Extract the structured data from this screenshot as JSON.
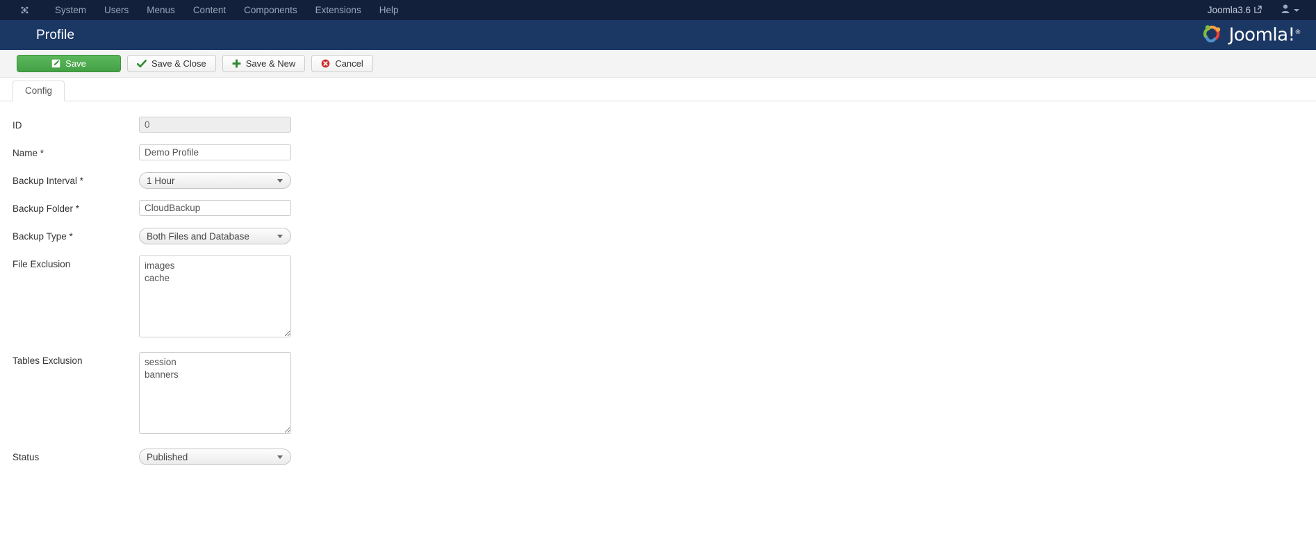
{
  "topnav": {
    "brand_icon": "joomla-emblem-icon",
    "menu": [
      {
        "label": "System"
      },
      {
        "label": "Users"
      },
      {
        "label": "Menus"
      },
      {
        "label": "Content"
      },
      {
        "label": "Components"
      },
      {
        "label": "Extensions"
      },
      {
        "label": "Help"
      }
    ],
    "site_link": {
      "label": "Joomla3.6",
      "icon": "external-link-icon"
    },
    "user_menu": {
      "icon": "user-icon",
      "caret": "chevron-down-icon"
    }
  },
  "header": {
    "title": "Profile",
    "logo_text": "Joomla!",
    "logo_reg": "®"
  },
  "toolbar": {
    "save_label": "Save",
    "save_close_label": "Save & Close",
    "save_new_label": "Save & New",
    "cancel_label": "Cancel"
  },
  "tabs": [
    {
      "label": "Config",
      "active": true
    }
  ],
  "form": {
    "fields": [
      {
        "label": "ID",
        "type": "text",
        "value": "0",
        "disabled": true
      },
      {
        "label": "Name *",
        "type": "text",
        "value": "Demo Profile",
        "disabled": false
      },
      {
        "label": "Backup Interval *",
        "type": "select",
        "value": "1 Hour"
      },
      {
        "label": "Backup Folder *",
        "type": "text",
        "value": "CloudBackup",
        "disabled": false
      },
      {
        "label": "Backup Type *",
        "type": "select",
        "value": "Both Files and Database"
      },
      {
        "label": "File Exclusion",
        "type": "textarea",
        "value": "images\ncache"
      },
      {
        "label": "Tables Exclusion",
        "type": "textarea",
        "value": "session\nbanners"
      },
      {
        "label": "Status",
        "type": "select",
        "value": "Published"
      }
    ]
  },
  "colors": {
    "topnav_bg": "#13203c",
    "header_bg": "#1b3764",
    "toolbar_bg": "#f4f4f4",
    "primary_green": "#5cb85c",
    "cancel_red": "#c9302c"
  }
}
